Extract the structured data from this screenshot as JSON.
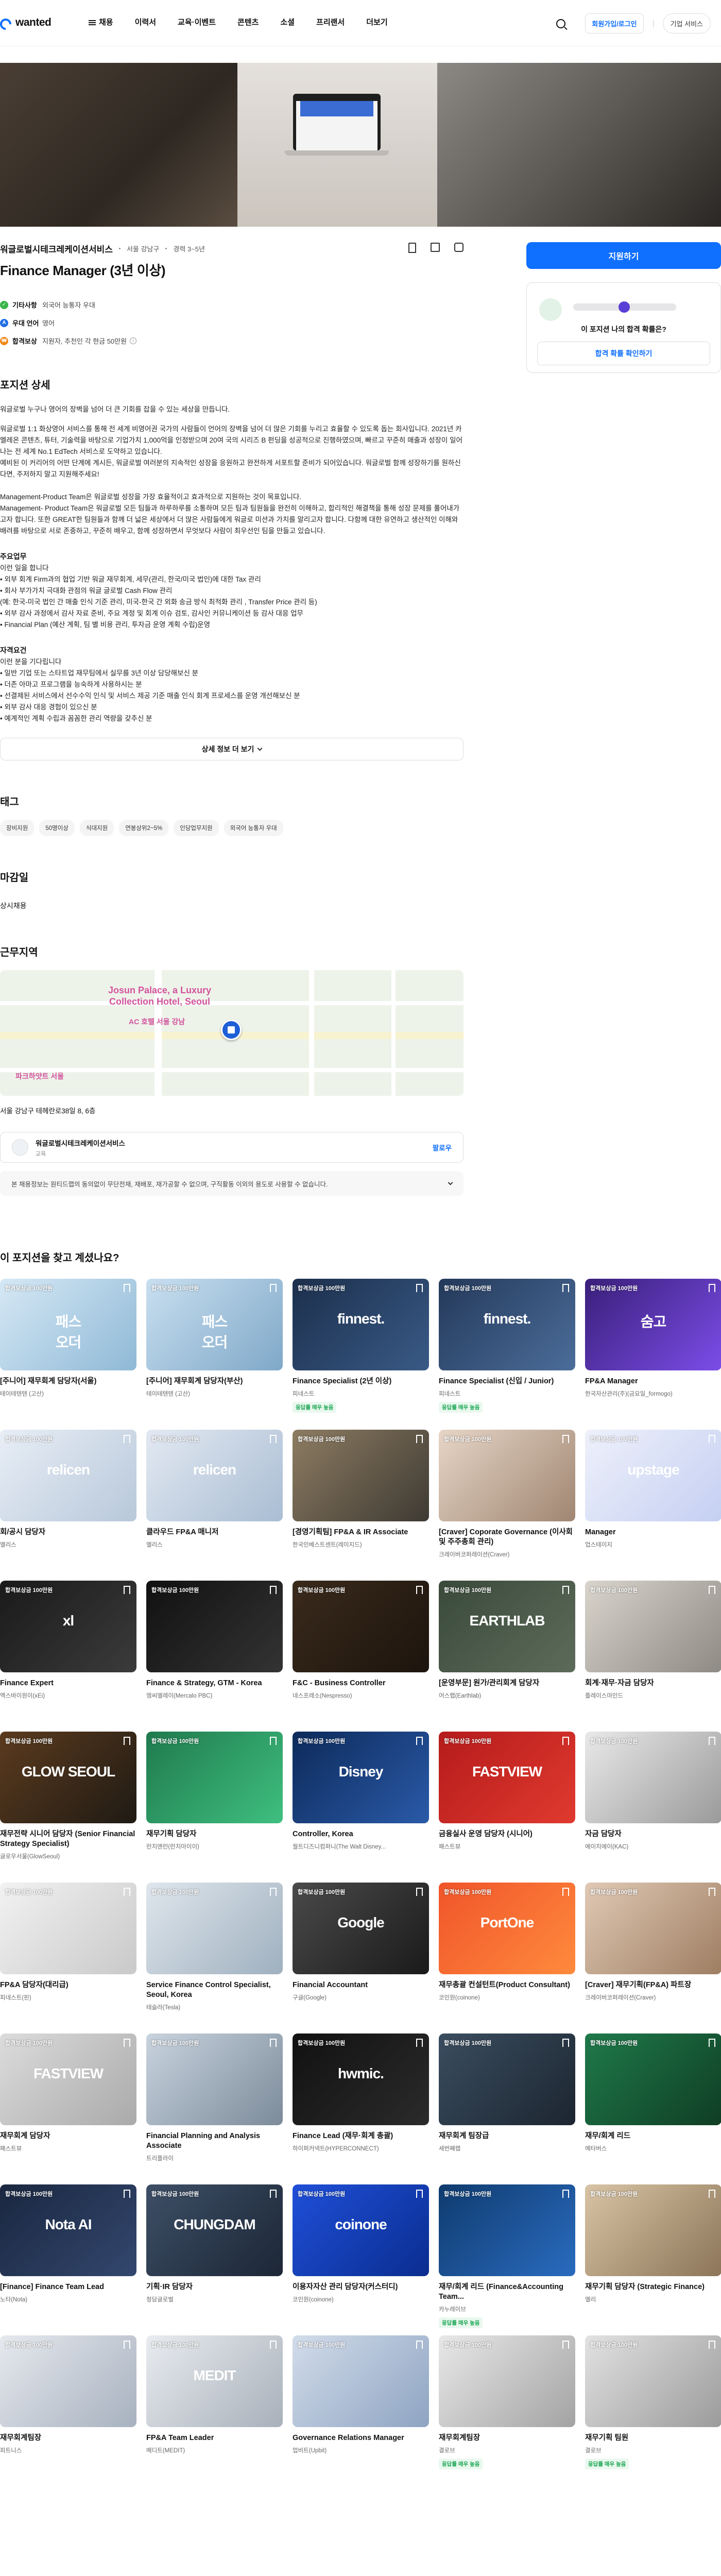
{
  "header": {
    "logo_text": "wanted",
    "nav": [
      "채용",
      "이력서",
      "교육·이벤트",
      "콘텐츠",
      "소셜",
      "프리랜서",
      "더보기"
    ],
    "login": "회원가입/로그인",
    "biz": "기업 서비스"
  },
  "job": {
    "company": "워글로벌시테크레케이션서비스",
    "location": "서울 강남구",
    "experience": "경력 3~5년",
    "title": "Finance Manager (3년 이상)",
    "tags": [
      {
        "label": "기타사항",
        "value": "외국어 능통자 우대",
        "color": "#3ab449"
      },
      {
        "label": "우대 언어",
        "value": "영어",
        "color": "#1f6fe5"
      },
      {
        "label": "합격보상",
        "value": "지원자, 추천인 각 현금 50만원",
        "color": "#f08a1c"
      }
    ],
    "apply": "지원하기",
    "match_question": "이 포지션 나의 합격 확률은?",
    "match_button": "합격 확률 확인하기"
  },
  "detail": {
    "heading": "포지션 상세",
    "intro": "워글로벌 누구나 영어의 장벽을 넘어 더 큰 기회를 잡을 수 있는 세상을 만듭니다.",
    "para1": "워글로벌 1:1 화상영어 서비스를 통해 전 세계 비영어권 국가의 사람들이 언어의 장벽을 넘어 더 많은 기회를 누리고 효율할 수 있도록 돕는 회사입니다. 2021년 카멜레온 콘텐츠, 튜터, 기술력을 바탕으로 기업가치 1,000억을 인정받으며 20여 국의 시리즈 B 펀딩을 성공적으로 진행하였으며, 빠르고 꾸준히 매출과 성장이 일어나는 전 세계 No.1 EdTech 서비스로 도약하고 있습니다.\n예비된 이 커리어의 어떤 단계에 계시든, 워글로벌 여러분의 지속적인 성장을 응원하고 완전하게 서포트할 준비가 되어있습니다. 워글로벌 함께 성장하기를 원하신다면, 주저하지 말고 지원해주세요!",
    "para2": "Management-Product Team은 워글로벌 성장을 가장 효율적이고 효과적으로 지원하는 것이 목표입니다.\nManagement- Product Team은 워글로벌 모든 팀들과 하루하루를 소통하며 모든 팀과 팀원들을 완전히 이해하고, 합리적인 해결책을 통해 성장 문제를 풀어내가고자 합니다. 또한 GREAT한 팀원들과 함께 더 넓은 세상에서 더 많은 사람들에게 워글로 미션과 가치를 알리고자 합니다. 다함께 대한 유연하고 생산적인 이해와 배려를 바탕으로 서로 존중하고, 꾸준히 배우고, 함께 성장하면서 무엇보다 사람이 최우선인 팀을 만들고 있습니다.",
    "duties_heading": "주요업무",
    "duties": "이런 일을 합니다\n• 외부 회계 Firm과의 협업 기반 워글 재무회계, 세무(관리, 한국/미국 법인)에 대한 Tax 관리\n• 회사 부가가치 극대화 관점의 워글 글로벌 Cash Flow 관리\n(예: 한국-미국 법인 간 매출 인식 기준 관리, 미국-한국 간 외화 송금 방식 최적화 관리 , Transfer Price 관리 등)\n• 외부 감사 과정에서 감사 자료 준비, 주요 계정 및 회계 이슈 검토, 감사인 커뮤니케이션 등 감사 대응 업무\n• Financial Plan (예산 계획, 팀 별 비용 관리, 투자금 운영 계획 수립)운영",
    "req_heading": "자격요건",
    "reqs": "이런 분을 기다립니다\n• 일반 기업 또는 스타트업 재무팀에서 실무를 3년 이상 담당해보신 분\n• 더존 아마고 프로그램을 능숙하게 사용하시는 분\n• 선결제된 서비스에서 선수수익 인식 및 서비스 제공 기준 매출 인식 회계 프로세스를 운영 개선해보신 분\n• 외부 감사 대응 경험이 있으신 분\n• 예계적인 계획 수립과 꼼꼼한 관리 역량을 갖추신 분",
    "more": "상세 정보 더 보기"
  },
  "tags_section": {
    "heading": "태그",
    "chips": [
      "장비지원",
      "50명이상",
      "식대지원",
      "연봉상위2~5%",
      "인당업무지원",
      "외국어 능통자 우대"
    ]
  },
  "deadline": {
    "heading": "마감일",
    "value": "상시채용"
  },
  "location": {
    "heading": "근무지역",
    "hotel": "Josun Palace, a Luxury\nCollection Hotel, Seoul",
    "map_label1": "AC 호텔 서울 강남",
    "map_label2": "파크하얏트 서울",
    "address": "서울 강남구 테헤란로38일 8, 6층"
  },
  "company_card": {
    "name": "워글로벌시테크레케이션서비스",
    "sub": "교육",
    "follow": "팔로우"
  },
  "notice": "본 채용정보는 원티드랩의 동의없이 무단전재, 재배포, 재가공할 수 없으며, 구직활동 이외의 용도로 사용할 수 없습니다.",
  "recommended": {
    "heading": "이 포지션을 찾고 계셨나요?",
    "items": [
      {
        "title": "[주니어] 재무회계 담당자(서울)",
        "company": "테이테텐텐 (고산)",
        "badge": "",
        "bg": "linear-gradient(135deg,#d6e8f5,#8fb9d6)",
        "brand": "패스\n오더"
      },
      {
        "title": "[주니어] 재무회계 담당자(부산)",
        "company": "테이테텐텐 (고산)",
        "badge": "",
        "bg": "linear-gradient(135deg,#c9dff0,#7fa8c8)",
        "brand": "패스\n오더"
      },
      {
        "title": "Finance Specialist (2년 이상)",
        "company": "피네스트",
        "badge": "응답률 매우 높음",
        "bg": "linear-gradient(135deg,#1c2f4c,#395a86)",
        "brand": "finnest."
      },
      {
        "title": "Finance Specialist (신입 / Junior)",
        "company": "피네스트",
        "badge": "응답률 매우 높음",
        "bg": "linear-gradient(135deg,#24395a,#4b6d9a)",
        "brand": "finnest."
      },
      {
        "title": "FP&A Manager",
        "company": "한국자산관리(주)(금요일_formogo)",
        "badge": "",
        "bg": "linear-gradient(135deg,#3a1f7a,#7b4de8)",
        "brand": "숨고"
      },
      {
        "title": "회/공시 담당자",
        "company": "엘리스",
        "badge": "",
        "bg": "linear-gradient(135deg,#e8eef6,#b8c8da)",
        "brand": "relicen"
      },
      {
        "title": "클라우드 FP&A 매니저",
        "company": "엘리스",
        "badge": "",
        "bg": "linear-gradient(135deg,#e3e9f2,#a9bdd3)",
        "brand": "relicen"
      },
      {
        "title": "[경영기획팀] FP&A & IR Associate",
        "company": "한국인베스트센트(레이지드)",
        "badge": "",
        "bg": "linear-gradient(135deg,#8d7c62,#3e3a33)",
        "brand": ""
      },
      {
        "title": "[Craver] Coporate Governance (이사회 및 주주총회 관리)",
        "company": "크레이버코퍼레이션(Craver)",
        "badge": "",
        "bg": "linear-gradient(135deg,#e6d5c6,#a08672)",
        "brand": ""
      },
      {
        "title": "Manager",
        "company": "업스테이지",
        "badge": "",
        "bg": "linear-gradient(135deg,#eef1fb,#c5cff2)",
        "brand": "upstage"
      },
      {
        "title": "Finance Expert",
        "company": "엑스바이원이(xEi)",
        "badge": "",
        "bg": "linear-gradient(135deg,#1a1a1a,#3b3b3b)",
        "brand": "xl"
      },
      {
        "title": "Finance & Strategy, GTM - Korea",
        "company": "엠씨엘레이(Mercalo PBC)",
        "badge": "",
        "bg": "linear-gradient(135deg,#111,#333)",
        "brand": ""
      },
      {
        "title": "F&C - Business Controller",
        "company": "네스프레소(Nespresso)",
        "badge": "",
        "bg": "linear-gradient(135deg,#3a2a1c,#1c140d)",
        "brand": ""
      },
      {
        "title": "[운영부문] 원가/관리회계 담당자",
        "company": "어스랩(Earthlab)",
        "badge": "",
        "bg": "linear-gradient(135deg,#3a4a3a,#5d6b5a)",
        "brand": "EARTHLAB"
      },
      {
        "title": "회계·재무·자금 담당자",
        "company": "플레이스마인드",
        "badge": "",
        "bg": "linear-gradient(135deg,#d9d4cc,#8e8a84)",
        "brand": ""
      },
      {
        "title": "재무전략 시니어 담당자 (Senior Financial Strategy Specialist)",
        "company": "글로우서울(GlowSeoul)",
        "badge": "",
        "bg": "linear-gradient(135deg,#5b3b1e,#1f1a14)",
        "brand": "GLOW SEOUL"
      },
      {
        "title": "재무기획 담당자",
        "company": "런치앤런(런치아이이)",
        "badge": "",
        "bg": "linear-gradient(135deg,#1f7a4d,#3fbf80)",
        "brand": ""
      },
      {
        "title": "Controller, Korea",
        "company": "월트디즈니컴퍼니(The Walt Disney...",
        "badge": "",
        "bg": "linear-gradient(135deg,#0d2a5a,#2a5aa8)",
        "brand": "Disney"
      },
      {
        "title": "금융실사 운영 담당자 (시니어)",
        "company": "패스트뷰",
        "badge": "",
        "bg": "linear-gradient(135deg,#b51b1b,#e03a2f)",
        "brand": "FASTVIEW"
      },
      {
        "title": "자금 담당자",
        "company": "에이치에이(KAC)",
        "badge": "",
        "bg": "linear-gradient(135deg,#e9e9e9,#9a9a9a)",
        "brand": ""
      },
      {
        "title": "FP&A 담당자(대리급)",
        "company": "피네스트(핀)",
        "badge": "",
        "bg": "linear-gradient(135deg,#f2f2f2,#c9c9c9)",
        "brand": ""
      },
      {
        "title": "Service Finance Control Specialist, Seoul, Korea",
        "company": "테슬라(Tesla)",
        "badge": "",
        "bg": "linear-gradient(135deg,#dfe6ec,#9fb0bf)",
        "brand": ""
      },
      {
        "title": "Financial Accountant",
        "company": "구글(Google)",
        "badge": "",
        "bg": "linear-gradient(135deg,#4a4a4a,#1a1a1a)",
        "brand": "Google"
      },
      {
        "title": "재무총괄 컨설턴트(Product Consultant)",
        "company": "코인원(coinone)",
        "badge": "",
        "bg": "linear-gradient(135deg,#f0552a,#ff8a3d)",
        "brand": "PortOne"
      },
      {
        "title": "[Craver] 재무기획(FP&A) 파트장",
        "company": "크레이버코퍼레이션(Craver)",
        "badge": "",
        "bg": "linear-gradient(135deg,#e0c9b5,#9e7e62)",
        "brand": ""
      },
      {
        "title": "재무회계 담당자",
        "company": "패스트뷰",
        "badge": "",
        "bg": "linear-gradient(135deg,#dcdcdc,#aaaaaa)",
        "brand": "FASTVIEW"
      },
      {
        "title": "Financial Planning and Analysis Associate",
        "company": "트리플라이",
        "badge": "",
        "bg": "linear-gradient(135deg,#c8d3de,#7c8b9a)",
        "brand": ""
      },
      {
        "title": "Finance Lead (재무·회계 총괄)",
        "company": "하이퍼커넥트(HYPERCONNECT)",
        "badge": "",
        "bg": "linear-gradient(135deg,#111,#2b2b2b)",
        "brand": "hwmic."
      },
      {
        "title": "재무회계 팀장급",
        "company": "세번째랩",
        "badge": "",
        "bg": "linear-gradient(135deg,#3a4d5f,#1c2530)",
        "brand": ""
      },
      {
        "title": "재무/회계 리드",
        "company": "메타버스",
        "badge": "",
        "bg": "linear-gradient(135deg,#1f7a4a,#0f3d24)",
        "brand": ""
      },
      {
        "title": "[Finance] Finance Team Lead",
        "company": "노타(Nota)",
        "badge": "",
        "bg": "linear-gradient(135deg,#1a2740,#33476e)",
        "brand": "Nota AI"
      },
      {
        "title": "기획·IR 담당자",
        "company": "청담글로벌",
        "badge": "",
        "bg": "linear-gradient(135deg,#3d4f66,#1c2636)",
        "brand": "CHUNGDAM"
      },
      {
        "title": "이용자자산 관리 담당자(커스터디)",
        "company": "코인원(coinone)",
        "badge": "",
        "bg": "linear-gradient(135deg,#1f4fd8,#0a2d8f)",
        "brand": "coinone"
      },
      {
        "title": "재무/회계 리드 (Finance&Accounting Team...",
        "company": "카누레이브",
        "badge": "응답률 매우 높음",
        "bg": "linear-gradient(135deg,#0f3b6e,#2a6bbf)",
        "brand": ""
      },
      {
        "title": "재무기획 담당자 (Strategic Finance)",
        "company": "엘리",
        "badge": "",
        "bg": "linear-gradient(135deg,#d8c4a5,#8c7558)",
        "brand": ""
      },
      {
        "title": "재무회계팀장",
        "company": "피트니스",
        "badge": "",
        "bg": "linear-gradient(135deg,#e6e9ee,#a7b1bf)",
        "brand": ""
      },
      {
        "title": "FP&A Team Leader",
        "company": "메디트(MEDIT)",
        "badge": "",
        "bg": "linear-gradient(135deg,#e9ecf0,#a8b0ba)",
        "brand": "MEDIT"
      },
      {
        "title": "Governance Relations Manager",
        "company": "업비트(Upbit)",
        "badge": "",
        "bg": "linear-gradient(135deg,#d2dcea,#8ea4c2)",
        "brand": ""
      },
      {
        "title": "재무회계팀장",
        "company": "결로브",
        "badge": "응답률 매우 높음",
        "bg": "linear-gradient(135deg,#e8e8e8,#a3a3a3)",
        "brand": ""
      },
      {
        "title": "재무기획 팀원",
        "company": "결로브",
        "badge": "응답률 매우 높음",
        "bg": "linear-gradient(135deg,#e2e2e2,#9b9b9b)",
        "brand": ""
      }
    ],
    "thumb_badge": "합격보상금 100만원"
  }
}
